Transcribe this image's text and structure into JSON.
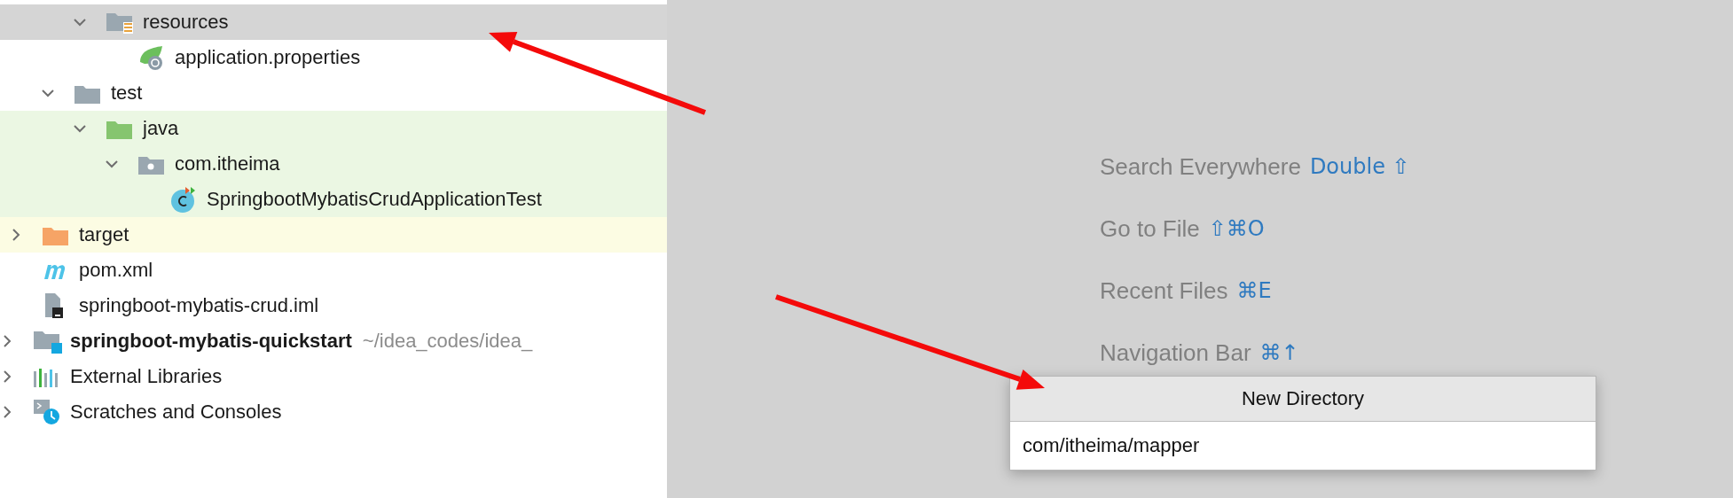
{
  "project_tree": [
    {
      "children": [
        {
          "children": [
            {
              "children": [
                {
                  "label": "resources",
                  "kind": "resources-folder",
                  "expanded": true,
                  "selected": true,
                  "children": [
                    {
                      "label": "application.properties",
                      "kind": "spring",
                      "selected": false
                    }
                  ]
                }
              ]
            },
            {
              "label": "test",
              "kind": "folder",
              "expanded": true,
              "selected": false,
              "children": [
                {
                  "label": "java",
                  "kind": "test-folder",
                  "expanded": true,
                  "selected": false,
                  "color": "#ebf7e3",
                  "children": [
                    {
                      "label": "com.itheima",
                      "kind": "package",
                      "expanded": true,
                      "selected": false,
                      "color": "#ebf7e3",
                      "children": [
                        {
                          "label": "SpringbootMybatisCrudApplicationTest",
                          "kind": "test-class",
                          "selected": false,
                          "color": "#ebf7e3"
                        }
                      ]
                    }
                  ]
                }
              ]
            }
          ]
        },
        {
          "label": "target",
          "kind": "excluded-folder",
          "expanded": false,
          "selected": false,
          "color": "#fcfce3"
        },
        {
          "label": "pom.xml",
          "kind": "maven",
          "selected": false
        },
        {
          "label": "springboot-mybatis-crud.iml",
          "kind": "iml",
          "selected": false
        }
      ]
    },
    {
      "label": "springboot-mybatis-quickstart",
      "path": "~/idea_codes/idea_",
      "kind": "module",
      "expanded": false,
      "selected": false
    },
    {
      "label": "External Libraries",
      "kind": "libraries",
      "expanded": false,
      "selected": false
    },
    {
      "label": "Scratches and Consoles",
      "kind": "scratches",
      "expanded": false,
      "selected": false
    }
  ],
  "hints": [
    {
      "label": "Search Everywhere",
      "shortcut": "Double ⇧"
    },
    {
      "label": "Go to File",
      "shortcut": "⇧⌘O"
    },
    {
      "label": "Recent Files",
      "shortcut": "⌘E"
    },
    {
      "label": "Navigation Bar",
      "shortcut": "⌘↑"
    }
  ],
  "dialog": {
    "title": "New Directory",
    "value": "com/itheima/mapper"
  }
}
